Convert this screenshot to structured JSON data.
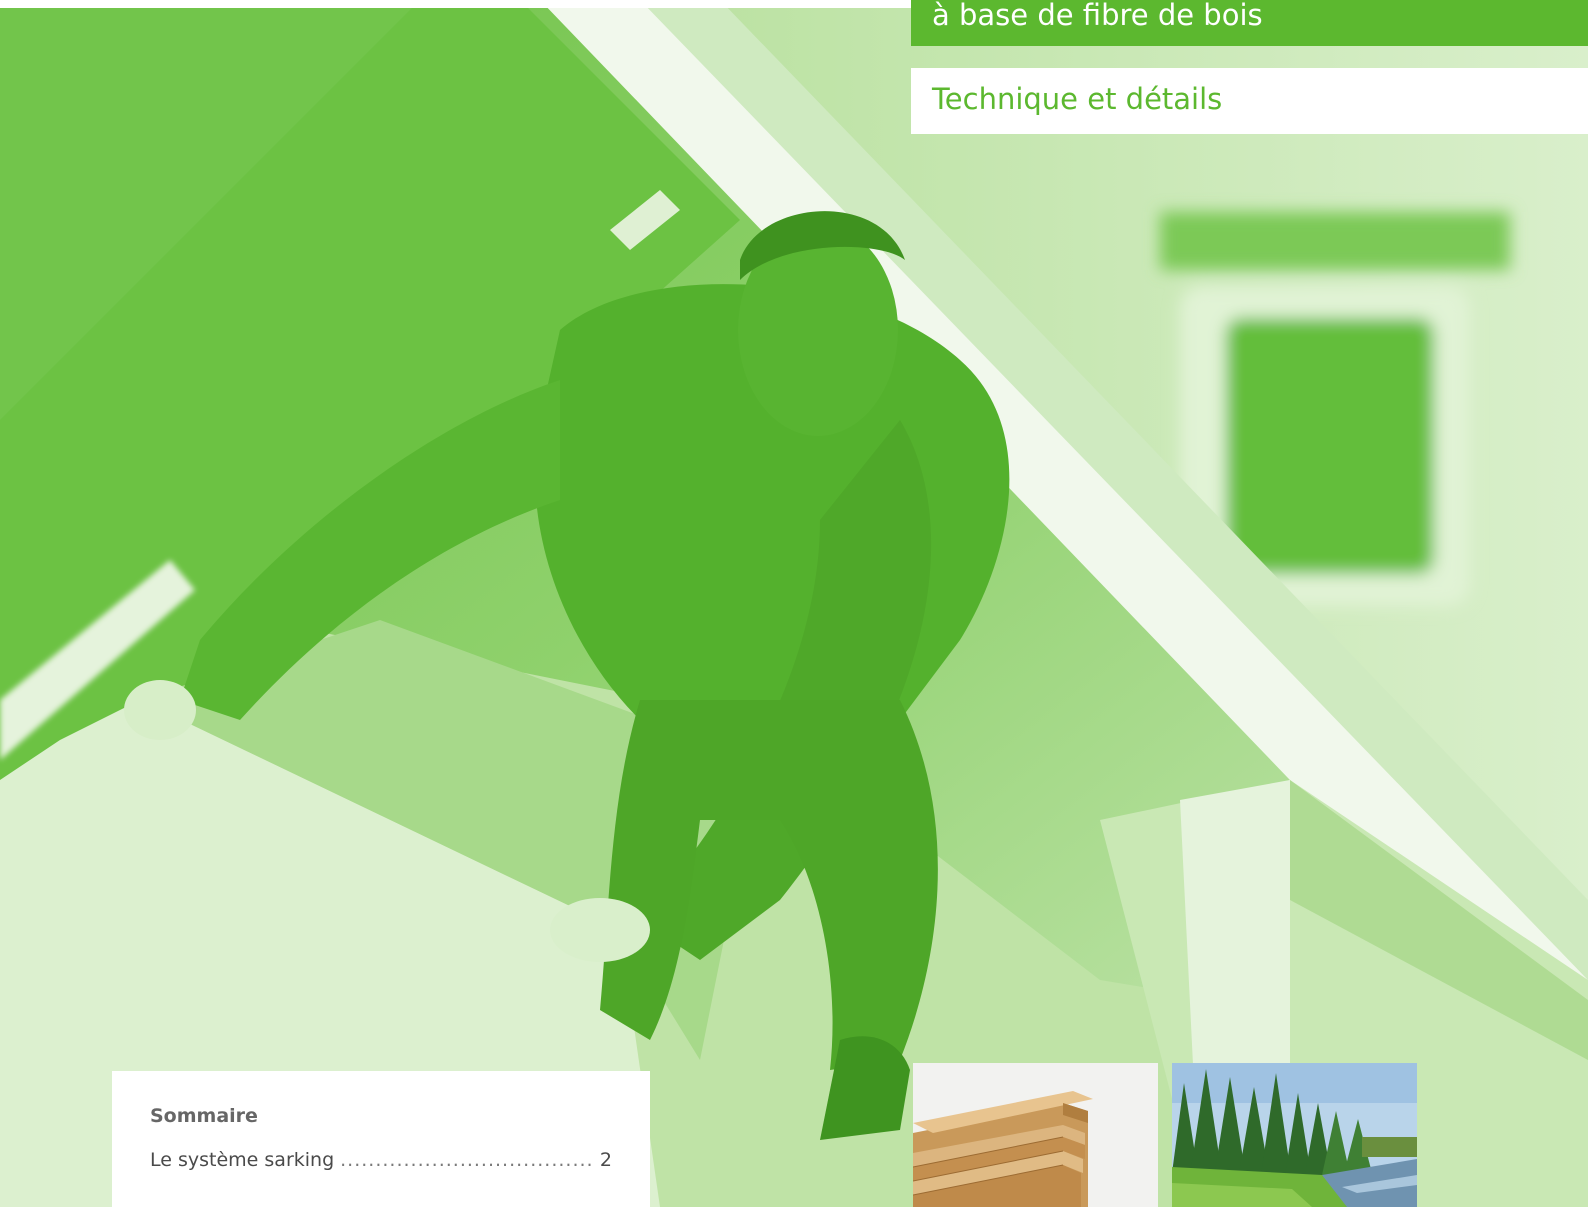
{
  "header": {
    "title_line": "à base de fibre de bois",
    "subtitle": "Technique et détails"
  },
  "contents": {
    "heading": "Sommaire",
    "items": [
      {
        "label": "Le système sarking",
        "page": "2"
      }
    ]
  },
  "photos": {
    "cover": "cover-photo-worker-on-roof",
    "thumb_1": "wood-fibre-boards-photo",
    "thumb_2": "forest-river-photo"
  },
  "colors": {
    "brand_green": "#5cb82f",
    "tint_light": "#c6e9b2",
    "tint_mid": "#8ed16a",
    "tint_dark": "#4aa228"
  }
}
